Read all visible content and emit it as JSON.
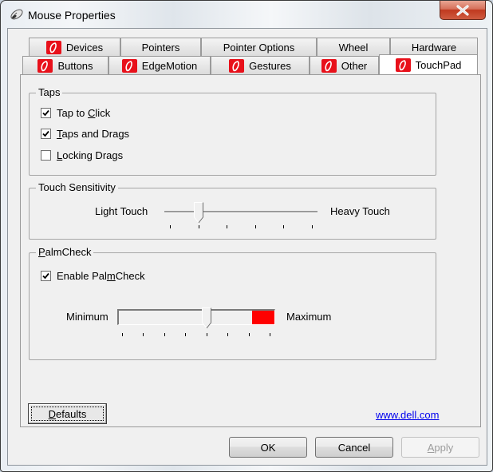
{
  "window": {
    "title": "Mouse Properties",
    "icon": "mouse-icon",
    "close_icon": "close-icon"
  },
  "tabs": {
    "row_top": [
      {
        "label": "Devices",
        "icon": "dell-synaptics-icon",
        "active": false
      },
      {
        "label": "Pointers",
        "icon": null,
        "active": false
      },
      {
        "label": "Pointer Options",
        "icon": null,
        "active": false
      },
      {
        "label": "Wheel",
        "icon": null,
        "active": false
      },
      {
        "label": "Hardware",
        "icon": null,
        "active": false
      }
    ],
    "row_bottom": [
      {
        "label": "Buttons",
        "icon": "dell-synaptics-icon",
        "active": false
      },
      {
        "label": "EdgeMotion",
        "icon": "dell-synaptics-icon",
        "active": false
      },
      {
        "label": "Gestures",
        "icon": "dell-synaptics-icon",
        "active": false
      },
      {
        "label": "Other",
        "icon": "dell-synaptics-icon",
        "active": false
      },
      {
        "label": "TouchPad",
        "icon": "dell-synaptics-icon",
        "active": true
      }
    ]
  },
  "taps": {
    "title": "Taps",
    "items": [
      {
        "pre": "Tap to ",
        "ul": "C",
        "post": "lick",
        "checked": true
      },
      {
        "pre": "",
        "ul": "T",
        "post": "aps and Drags",
        "checked": true
      },
      {
        "pre": "",
        "ul": "L",
        "post": "ocking Drags",
        "checked": false
      }
    ]
  },
  "touch_sensitivity": {
    "title": "Touch Sensitivity",
    "min_label": "Light Touch",
    "max_label": "Heavy Touch",
    "tick_count": 6,
    "position_step": 1
  },
  "palmcheck": {
    "title_ul": "P",
    "title_rest": "almCheck",
    "enable": {
      "pre": "Enable Pal",
      "ul": "m",
      "post": "Check",
      "checked": true
    },
    "min_label": "Minimum",
    "max_label": "Maximum",
    "tick_count": 8,
    "position_step": 4,
    "fill_color": "#ff0000"
  },
  "footer": {
    "defaults_ul": "D",
    "defaults_rest": "efaults",
    "link": "www.dell.com"
  },
  "buttons": {
    "ok": "OK",
    "cancel": "Cancel",
    "apply_ul": "A",
    "apply_rest": "pply",
    "apply_enabled": false
  }
}
